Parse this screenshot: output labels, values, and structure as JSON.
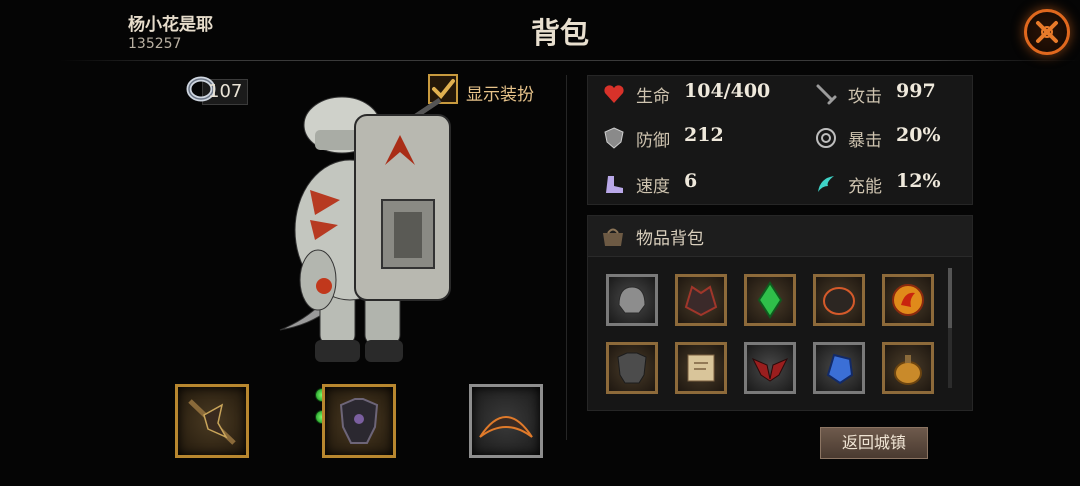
{
  "header": {
    "player_name": "杨小花是耶",
    "player_id": "135257",
    "title": "背包",
    "close_icon": "close-x-icon"
  },
  "currency": {
    "value": "107",
    "icon": "ring-icon"
  },
  "outfit_toggle": {
    "label": "显示装扮",
    "checked": true
  },
  "stats": {
    "health": {
      "label": "生命",
      "value": "104/400",
      "icon": "heart-icon"
    },
    "attack": {
      "label": "攻击",
      "value": "997",
      "icon": "sword-icon"
    },
    "defense": {
      "label": "防御",
      "value": "212",
      "icon": "shield-icon"
    },
    "crit": {
      "label": "暴击",
      "value": "20%",
      "icon": "crit-target-icon"
    },
    "speed": {
      "label": "速度",
      "value": "6",
      "icon": "boot-icon"
    },
    "charge": {
      "label": "充能",
      "value": "12%",
      "icon": "charge-swirl-icon"
    }
  },
  "inventory": {
    "title": "物品背包",
    "icon": "bag-icon",
    "items": [
      "helmet-item-icon",
      "dark-helm-item-icon",
      "green-gem-item-icon",
      "ember-helm-item-icon",
      "fire-orb-item-icon",
      "chest-armor-item-icon",
      "scroll-item-icon",
      "demon-wings-item-icon",
      "blue-crystal-item-icon",
      "potion-item-icon"
    ]
  },
  "equipment": {
    "weapon": "axe-weapon-icon",
    "armor": "dark-armor-icon",
    "accessory": "claw-blade-icon"
  },
  "return_button": {
    "label": "返回城镇"
  },
  "colors": {
    "accent_orange": "#e0681e",
    "gold_border": "#b8872f",
    "panel_bg": "#171717"
  }
}
